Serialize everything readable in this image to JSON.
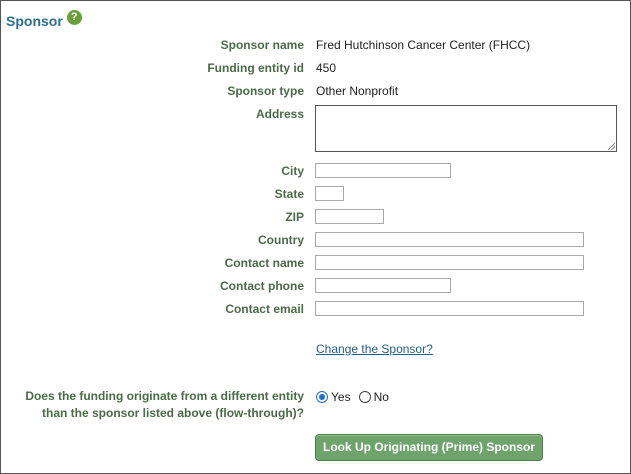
{
  "header": {
    "title": "Sponsor",
    "help_icon": "?"
  },
  "fields": {
    "sponsor_name": {
      "label": "Sponsor name",
      "value": "Fred Hutchinson Cancer Center (FHCC)"
    },
    "funding_entity_id": {
      "label": "Funding entity id",
      "value": "450"
    },
    "sponsor_type": {
      "label": "Sponsor type",
      "value": "Other Nonprofit"
    },
    "address": {
      "label": "Address",
      "value": ""
    },
    "city": {
      "label": "City",
      "value": ""
    },
    "state": {
      "label": "State",
      "value": ""
    },
    "zip": {
      "label": "ZIP",
      "value": ""
    },
    "country": {
      "label": "Country",
      "value": ""
    },
    "contact_name": {
      "label": "Contact name",
      "value": ""
    },
    "contact_phone": {
      "label": "Contact phone",
      "value": ""
    },
    "contact_email": {
      "label": "Contact email",
      "value": ""
    }
  },
  "change_sponsor_link": "Change the Sponsor?",
  "flow_through": {
    "question_line1": "Does the funding originate from a different entity",
    "question_line2": "than the sponsor listed above (flow-through)?",
    "options": [
      {
        "label": "Yes",
        "checked": true
      },
      {
        "label": "No",
        "checked": false
      }
    ]
  },
  "lookup_button": "Look Up Originating (Prime) Sponsor",
  "colors": {
    "title": "#2c6f8f",
    "label": "#4a6b47",
    "link": "#1f5f8b",
    "button": "#6ea36b",
    "help_icon": "#6a9e3a",
    "radio_selected": "#1a6fd1"
  }
}
